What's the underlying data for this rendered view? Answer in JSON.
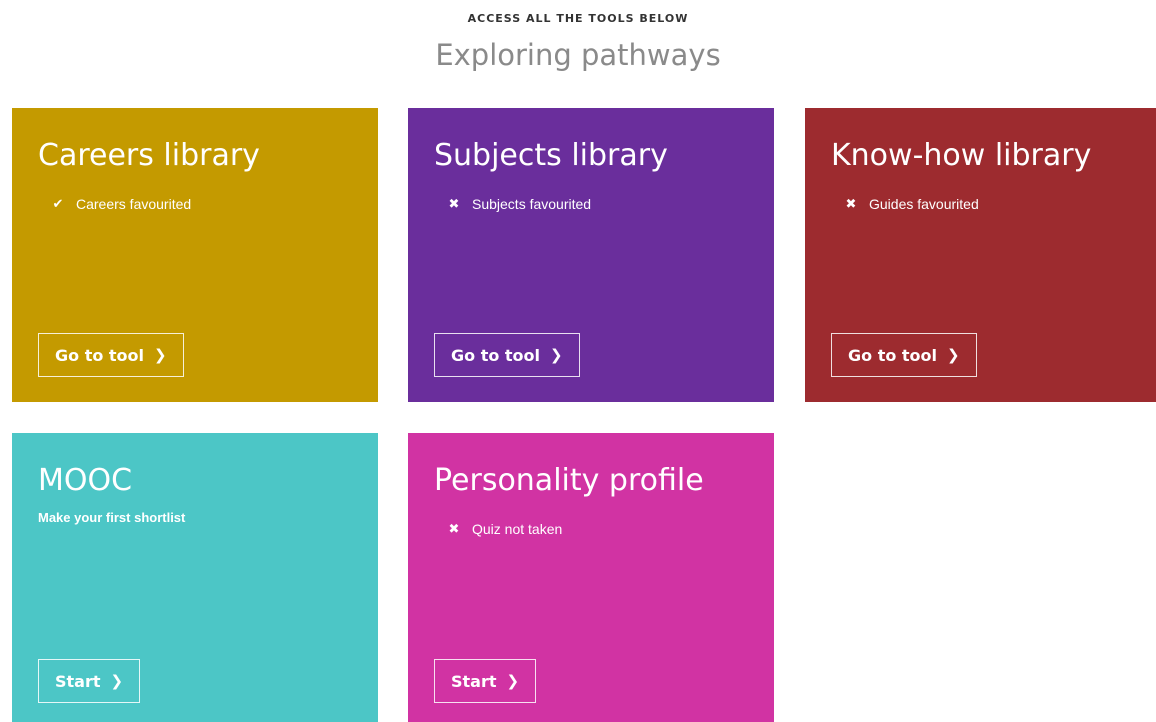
{
  "header": {
    "eyebrow": "ACCESS ALL THE TOOLS BELOW",
    "title": "Exploring pathways"
  },
  "cards": [
    {
      "title": "Careers library",
      "status": "Careers favourited",
      "status_icon": "checkmark-icon",
      "status_glyph": "✔",
      "button": "Go to tool",
      "color": "#c49a00"
    },
    {
      "title": "Subjects library",
      "status": "Subjects favourited",
      "status_icon": "cross-icon",
      "status_glyph": "✖",
      "button": "Go to tool",
      "color": "#6a2e9c"
    },
    {
      "title": "Know-how library",
      "status": "Guides favourited",
      "status_icon": "cross-icon",
      "status_glyph": "✖",
      "button": "Go to tool",
      "color": "#9d2b2f"
    },
    {
      "title": "MOOC",
      "subtitle": "Make your first shortlist",
      "button": "Start",
      "color": "#4cc6c6"
    },
    {
      "title": "Personality profile",
      "status": "Quiz not taken",
      "status_icon": "cross-icon",
      "status_glyph": "✖",
      "button": "Start",
      "color": "#d133a3"
    }
  ],
  "icons": {
    "chevron_glyph": "❯",
    "chevron_name": "chevron-right-icon"
  }
}
